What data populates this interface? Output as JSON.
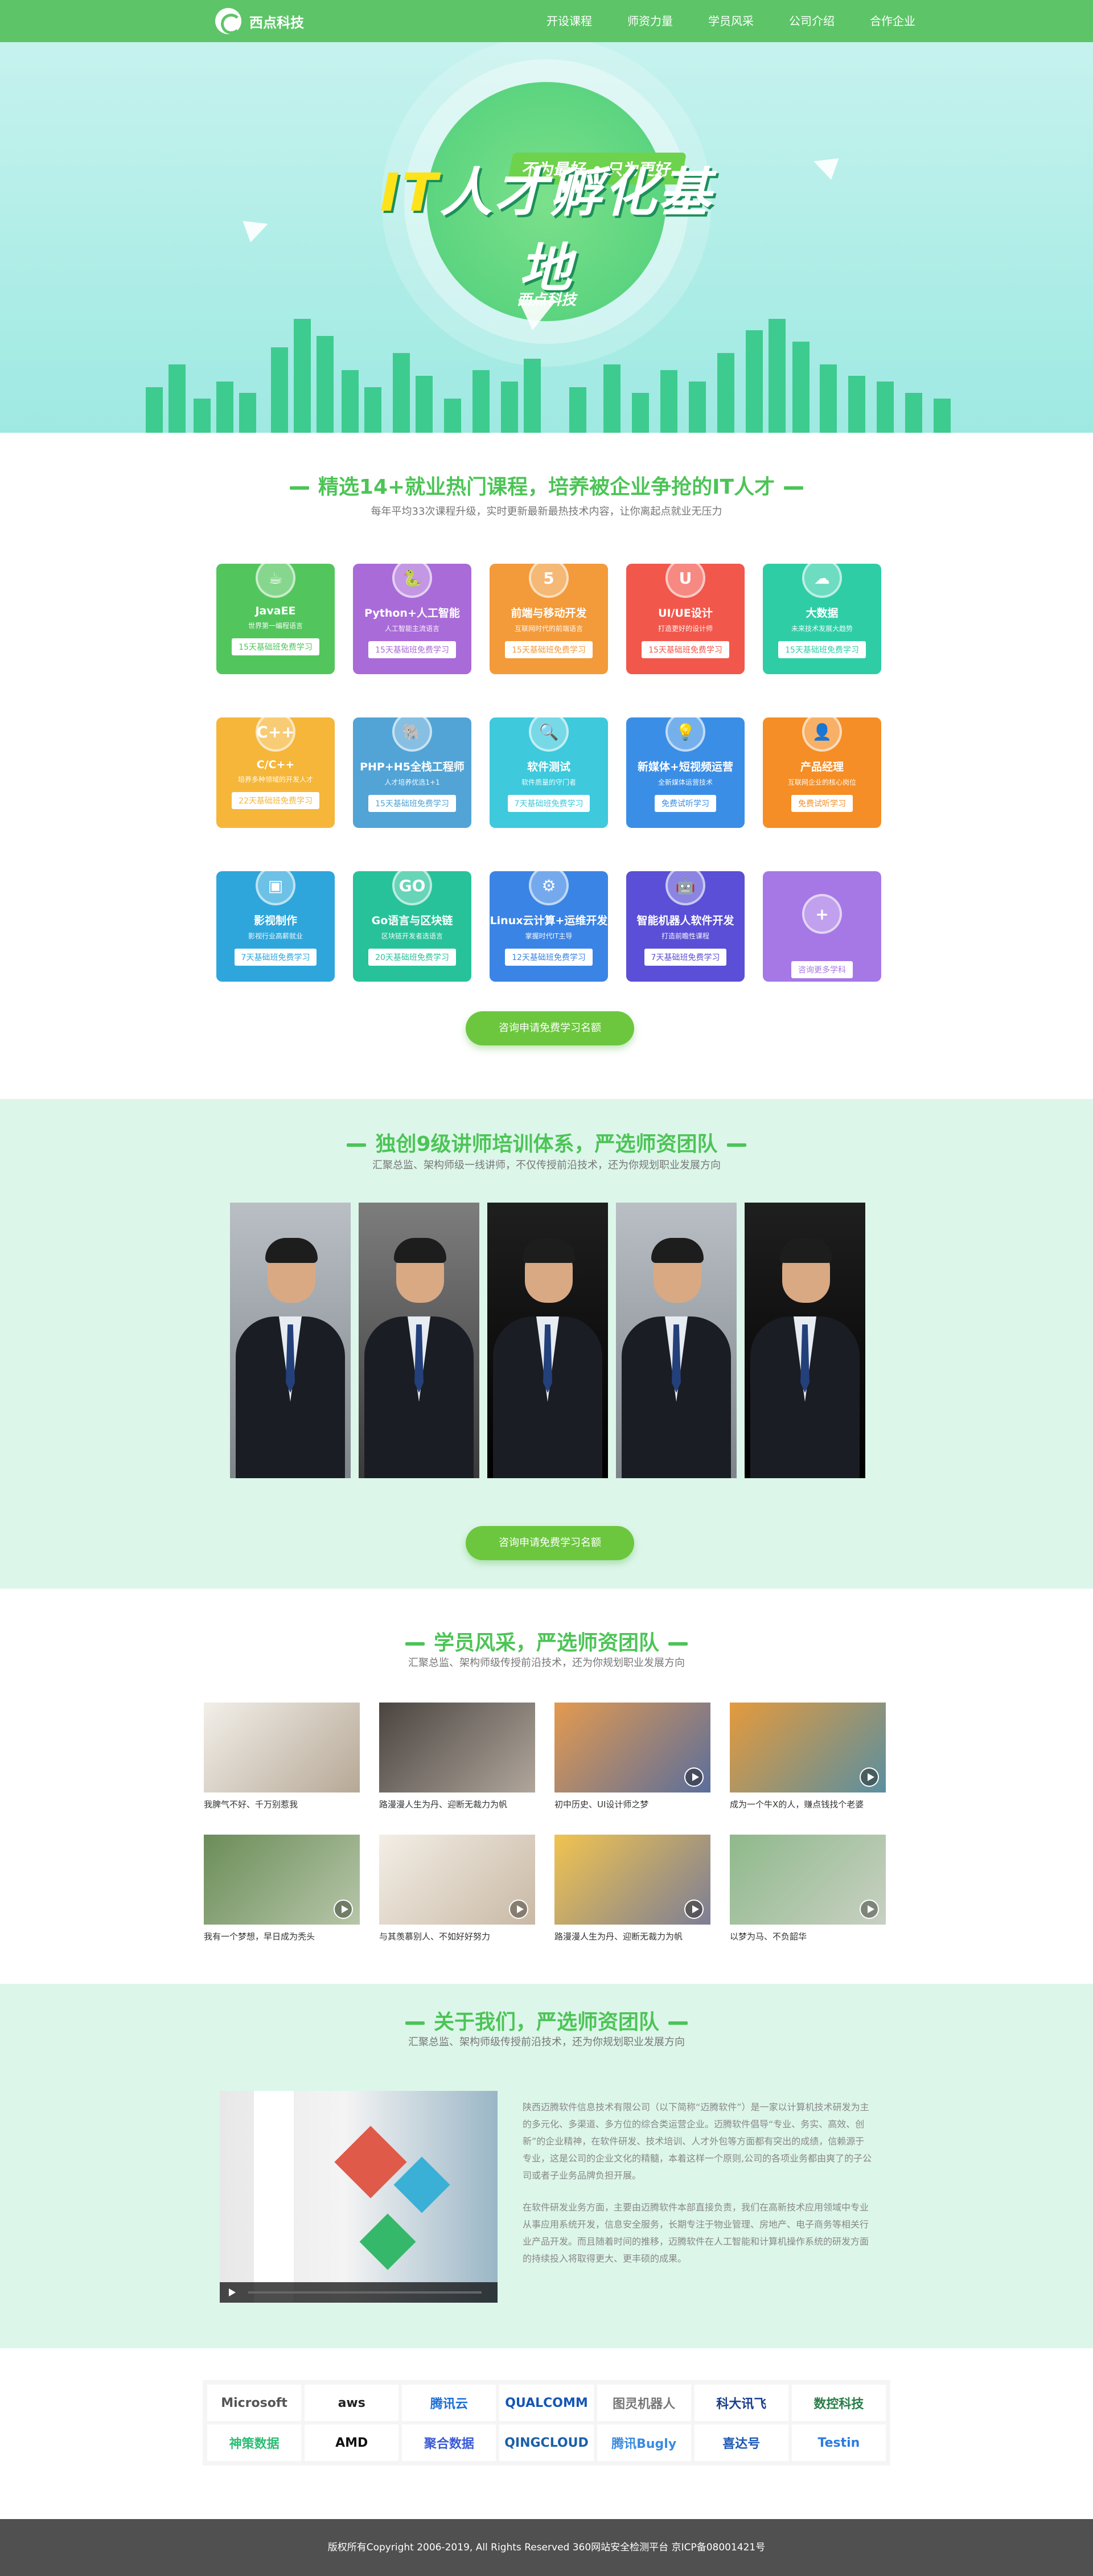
{
  "header": {
    "brand": "西点科技",
    "nav": [
      "开设课程",
      "师资力量",
      "学员风采",
      "公司介绍",
      "合作企业"
    ]
  },
  "hero": {
    "tagline": "不为最好 • 只为更好",
    "title_it": "IT",
    "title_rest": "人才孵化基地",
    "brand": "西点科技"
  },
  "courses": {
    "title": "精选14+就业热门课程，培养被企业争抢的IT人才",
    "subtitle": "每年平均33次课程升级，实时更新最新最热技术内容，让你离起点就业无压力",
    "items": [
      {
        "name": "JavaEE",
        "desc": "世界第一编程语言",
        "button": "15天基础班免费学习",
        "color": "#52c65c",
        "icon": "☕"
      },
      {
        "name": "Python+人工智能",
        "desc": "人工智能主流语言",
        "button": "15天基础班免费学习",
        "color": "#a96bd8",
        "icon": "🐍"
      },
      {
        "name": "前端与移动开发",
        "desc": "互联网时代的前端语言",
        "button": "15天基础班免费学习",
        "color": "#f39a3a",
        "icon": "5"
      },
      {
        "name": "UI/UE设计",
        "desc": "打造更好的设计师",
        "button": "15天基础班免费学习",
        "color": "#f2574b",
        "icon": "U"
      },
      {
        "name": "大数据",
        "desc": "未来技术发展大趋势",
        "button": "15天基础班免费学习",
        "color": "#2fcda6",
        "icon": "☁"
      },
      {
        "name": "C/C++",
        "desc": "培养多种领域的开发人才",
        "button": "22天基础班免费学习",
        "color": "#f5b63a",
        "icon": "C++"
      },
      {
        "name": "PHP+H5全栈工程师",
        "desc": "人才培养优选1+1",
        "button": "15天基础班免费学习",
        "color": "#52a4d6",
        "icon": "🐘"
      },
      {
        "name": "软件测试",
        "desc": "软件质量的守门者",
        "button": "7天基础班免费学习",
        "color": "#3ec9dc",
        "icon": "🔍"
      },
      {
        "name": "新媒体+短视频运营",
        "desc": "全新媒体运营技术",
        "button": "免费试听学习",
        "color": "#3a8ee6",
        "icon": "💡"
      },
      {
        "name": "产品经理",
        "desc": "互联网企业的核心岗位",
        "button": "免费试听学习",
        "color": "#f58e26",
        "icon": "👤"
      },
      {
        "name": "影视制作",
        "desc": "影视行业高薪就业",
        "button": "7天基础班免费学习",
        "color": "#2ea6dc",
        "icon": "▣"
      },
      {
        "name": "Go语言与区块链",
        "desc": "区块链开发者选语言",
        "button": "20天基础班免费学习",
        "color": "#28c29a",
        "icon": "GO"
      },
      {
        "name": "Linux云计算+运维开发",
        "desc": "掌握时代IT主导",
        "button": "12天基础班免费学习",
        "color": "#3a84e6",
        "icon": "⚙"
      },
      {
        "name": "智能机器人软件开发",
        "desc": "打造前瞻性课程",
        "button": "7天基础班免费学习",
        "color": "#5a4fd6",
        "icon": "🤖"
      },
      {
        "name": "",
        "desc": "",
        "button": "咨询更多学科",
        "color": "#a678e6",
        "icon": "+"
      }
    ],
    "cta": "咨询申请免费学习名额"
  },
  "teachers": {
    "title": "独创9级讲师培训体系，严选师资团队",
    "subtitle": "汇聚总监、架构师级一线讲师，不仅传授前沿技术，还为你规划职业发展方向",
    "cta": "咨询申请免费学习名额"
  },
  "students": {
    "title": "学员风采，严选师资团队",
    "subtitle": "汇聚总监、架构师级传授前沿技术，还为你规划职业发展方向",
    "items": [
      {
        "caption": "我脾气不好、千万别惹我",
        "video": false
      },
      {
        "caption": "路漫漫人生为丹、迎断无裁力为帆",
        "video": false
      },
      {
        "caption": "初中历史、UI设计师之梦",
        "video": true
      },
      {
        "caption": "成为一个牛X的人，赚点钱找个老婆",
        "video": true
      },
      {
        "caption": "我有一个梦想，早日成为秃头",
        "video": true
      },
      {
        "caption": "与其羡慕别人、不如好好努力",
        "video": true
      },
      {
        "caption": "路漫漫人生为丹、迎断无裁力为帆",
        "video": true
      },
      {
        "caption": "以梦为马、不负韶华",
        "video": true
      }
    ]
  },
  "about": {
    "title": "关于我们，严选师资团队",
    "subtitle": "汇聚总监、架构师级传授前沿技术，还为你规划职业发展方向",
    "p1": "陕西迈腾软件信息技术有限公司（以下简称“迈腾软件”）是一家以计算机技术研发为主的多元化、多渠道、多方位的综合类运营企业。迈腾软件倡导“专业、务实、高效、创新”的企业精神，在软件研发、技术培训、人才外包等方面都有突出的成绩，信赖源于专业，这是公司的企业文化的精髓，本着这样一个原则,公司的各项业务都由爽了的子公司或者子业务品牌负担开展。",
    "p2": "在软件研发业务方面，主要由迈腾软件本部直接负责，我们在高新技术应用领域中专业从事应用系统开发，信息安全服务，长期专注于物业管理、房地产、电子商务等相关行业产品开发。而且随着时间的推移，迈腾软件在人工智能和计算机操作系统的研发方面的持续投入将取得更大、更丰硕的成果。"
  },
  "partners": [
    "Microsoft",
    "aws",
    "腾讯云",
    "QUALCOMM",
    "图灵机器人",
    "科大讯飞",
    "数控科技",
    "神策数据",
    "AMD",
    "聚合数据",
    "QINGCLOUD",
    "腾讯Bugly",
    "喜达号",
    "Testin"
  ],
  "footer": "版权所有Copyright 2006-2019, All Rights Reserved    360网站安全检测平台    京ICP备08001421号"
}
